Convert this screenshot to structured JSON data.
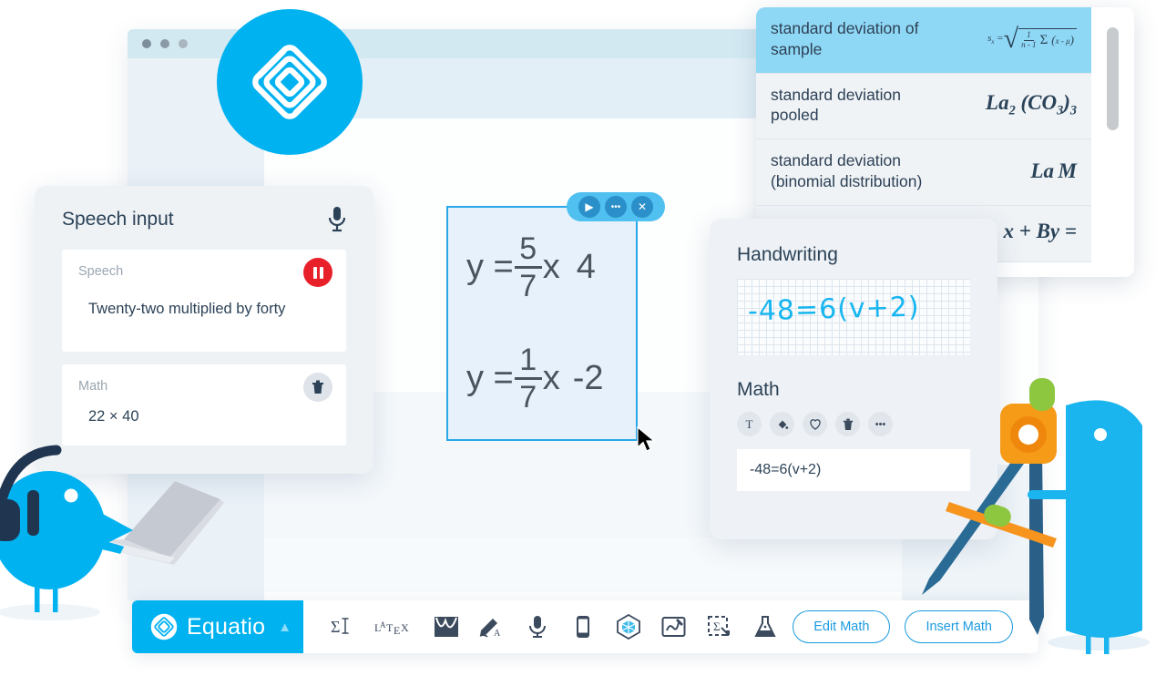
{
  "browser": {
    "traffic_lights": [
      "close-dot",
      "minimize-dot",
      "maximize-dot"
    ]
  },
  "brand": {
    "name": "Equatio",
    "accent": "#00b2f0",
    "logo_icon": "equatio-diamond-logo"
  },
  "predictions": {
    "scrollbar": "vertical-scrollbar",
    "rows": [
      {
        "label": "standard deviation of sample",
        "formula": "s_x = sqrt( 1/(n-1) SUM (x-u) )",
        "selected": true
      },
      {
        "label": "standard deviation pooled",
        "formula": "La2 (CO3)3",
        "selected": false
      },
      {
        "label": "standard deviation (binomial distribution)",
        "formula": "La M",
        "selected": false
      },
      {
        "label": "",
        "formula": "x + By =",
        "selected": false
      }
    ]
  },
  "speech_card": {
    "title": "Speech input",
    "mic_icon": "microphone-icon",
    "speech": {
      "label": "Speech",
      "value": "Twenty-two multiplied by forty",
      "action_icon": "pause-icon"
    },
    "math": {
      "label": "Math",
      "value": "22 × 40",
      "action_icon": "trash-icon"
    }
  },
  "equation_box": {
    "lines": [
      {
        "lhs": "y =",
        "num": "5",
        "den": "7",
        "var": "x",
        "tail": "4"
      },
      {
        "lhs": "y =",
        "num": "1",
        "den": "7",
        "var": "x",
        "tail": "-2"
      }
    ],
    "toolbar": [
      {
        "icon": "play-icon",
        "glyph": "▶"
      },
      {
        "icon": "more-options-icon",
        "glyph": "•••"
      },
      {
        "icon": "close-icon",
        "glyph": "✕"
      }
    ],
    "cursor_icon": "mouse-pointer-icon"
  },
  "handwriting_card": {
    "title": "Handwriting",
    "ink_value": "-48=6(v+2)",
    "math_title": "Math",
    "tools": [
      {
        "icon": "text-format-icon",
        "glyph": "T"
      },
      {
        "icon": "fill-color-icon",
        "glyph": "◆"
      },
      {
        "icon": "favorite-heart-icon",
        "glyph": "♡"
      },
      {
        "icon": "trash-icon",
        "glyph": "🗑"
      },
      {
        "icon": "more-options-icon",
        "glyph": "•••"
      }
    ],
    "result_value": "-48=6(v+2)"
  },
  "bottom_bar": {
    "brand_label": "Equatio",
    "chevron_icon": "chevron-up-icon",
    "tools": [
      {
        "icon": "equation-editor-icon",
        "glyph": "Σ"
      },
      {
        "icon": "latex-icon",
        "glyph": "LaTeX"
      },
      {
        "icon": "graph-editor-icon",
        "glyph": "graph"
      },
      {
        "icon": "handwriting-icon",
        "glyph": "pencil"
      },
      {
        "icon": "speech-input-icon",
        "glyph": "mic"
      },
      {
        "icon": "mobile-icon",
        "glyph": "phone"
      },
      {
        "icon": "molecule-3d-icon",
        "glyph": "cube"
      },
      {
        "icon": "screenshot-draw-icon",
        "glyph": "draw"
      },
      {
        "icon": "screenshot-reader-icon",
        "glyph": "capture"
      },
      {
        "icon": "chemistry-icon",
        "glyph": "flask"
      }
    ],
    "actions": [
      {
        "label": "Edit Math",
        "name": "edit-math-button"
      },
      {
        "label": "Insert Math",
        "name": "insert-math-button"
      }
    ]
  },
  "mascots": {
    "left": "bird-with-laptop-and-headphones",
    "right": "bird-with-compass-and-pencil"
  }
}
